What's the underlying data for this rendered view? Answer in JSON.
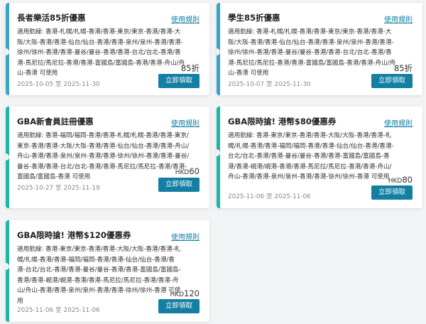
{
  "theme": {
    "accent": "#137fa3",
    "stripe_blue": "#3aa6c6",
    "stripe_teal": "#1fb5a6",
    "background": "#f2f3f5"
  },
  "coupons": [
    {
      "title": "長者樂活85折優惠",
      "rules_label": "使用規則",
      "routes": "適用航線: 香港-札幌/札幌-香港/香港-東京/東京-香港/香港-大阪/大阪-香港/香港-仙台/仙台-香港/香港-泉州/泉州-香港/香港-徐州/徐州-香港/香港-曼谷/曼谷-香港/香港-台北/台北-香港/香港-馬尼拉/馬尼拉-香港/香港-富國島/富國島-香港/香港-舟山/舟山-香港 可使用",
      "discount_currency": "",
      "discount_value": "85折",
      "date_range": "2025-10-05 至 2025-11-30",
      "claim_label": "立即領取"
    },
    {
      "title": "學生85折優惠",
      "rules_label": "使用規則",
      "routes": "適用航線: 香港-札幌/札幌-香港/香港-東京/東京-香港/香港-大阪/大阪-香港/香港-仙台/仙台-香港/香港-泉州/泉州-香港/香港-徐州/徐州-香港/香港-曼谷/曼谷-香港/香港-台北/台北-香港/香港-馬尼拉/馬尼拉-香港/香港-富國島/富國島-香港/香港-舟山/舟山-香港 可使用",
      "discount_currency": "",
      "discount_value": "85折",
      "date_range": "2025-10-07 至 2025-11-30",
      "claim_label": "立即領取"
    },
    {
      "title": "GBA新會員註冊優惠",
      "rules_label": "使用規則",
      "routes": "適用航線: 香港-福岡/福岡-香港/香港-札幌/札幌-香港/香港-東京/東京-香港/香港-大阪/大阪-香港/香港-仙台/仙台-香港/香港-舟山/舟山-香港/香港-泉州/泉州-香港/香港-徐州/徐州-香港/香港-曼谷/曼谷-香港/香港-台北/台北-香港/香港-馬尼拉/馬尼拉-香港/香港-富國島/富國島-香港 可使用",
      "discount_currency": "HKD",
      "discount_value": "60",
      "date_range": "2025-10-27 至 2025-11-19",
      "claim_label": "立即領取"
    },
    {
      "title": "GBA限時搶! 港幣$80優惠券",
      "rules_label": "使用規則",
      "routes": "適用航線: 香港-東京/東京-香港/香港-大阪/大阪-香港/香港-札幌/札幌-香港/香港-福岡/福岡-香港/香港-仙台/仙台-香港/香港-台北/台北-香港/香港-曼谷/曼谷-香港/香港-富國島/富國島-香港/香港-峴港/峴港-香港/香港-馬尼拉/馬尼拉-香港/香港-舟山/舟山-香港/香港-泉州/泉州-香港/香港-徐州/徐州-香港 可使用",
      "discount_currency": "HKD",
      "discount_value": "80",
      "date_range": "2025-11-06 至 2025-11-06",
      "claim_label": "立即領取"
    },
    {
      "title": "GBA限時搶! 港幣$120優惠券",
      "rules_label": "使用規則",
      "routes": "適用航線: 香港-東京/東京-香港/香港-大阪/大阪-香港/香港-札幌/札幌-香港/香港-福岡/福岡-香港/香港-仙台/仙台-香港/香港-台北/台北-香港/香港-曼谷/曼谷-香港/香港-富國島/富國島-香港/香港-峴港/峴港-香港/香港-馬尼拉/馬尼拉-香港/香港-舟山/舟山-香港/香港-泉州/泉州-香港/香港-徐州/徐州-香港 可使用",
      "discount_currency": "HKD",
      "discount_value": "120",
      "date_range": "2025-11-06 至 2025-11-06",
      "claim_label": "立即領取"
    }
  ]
}
